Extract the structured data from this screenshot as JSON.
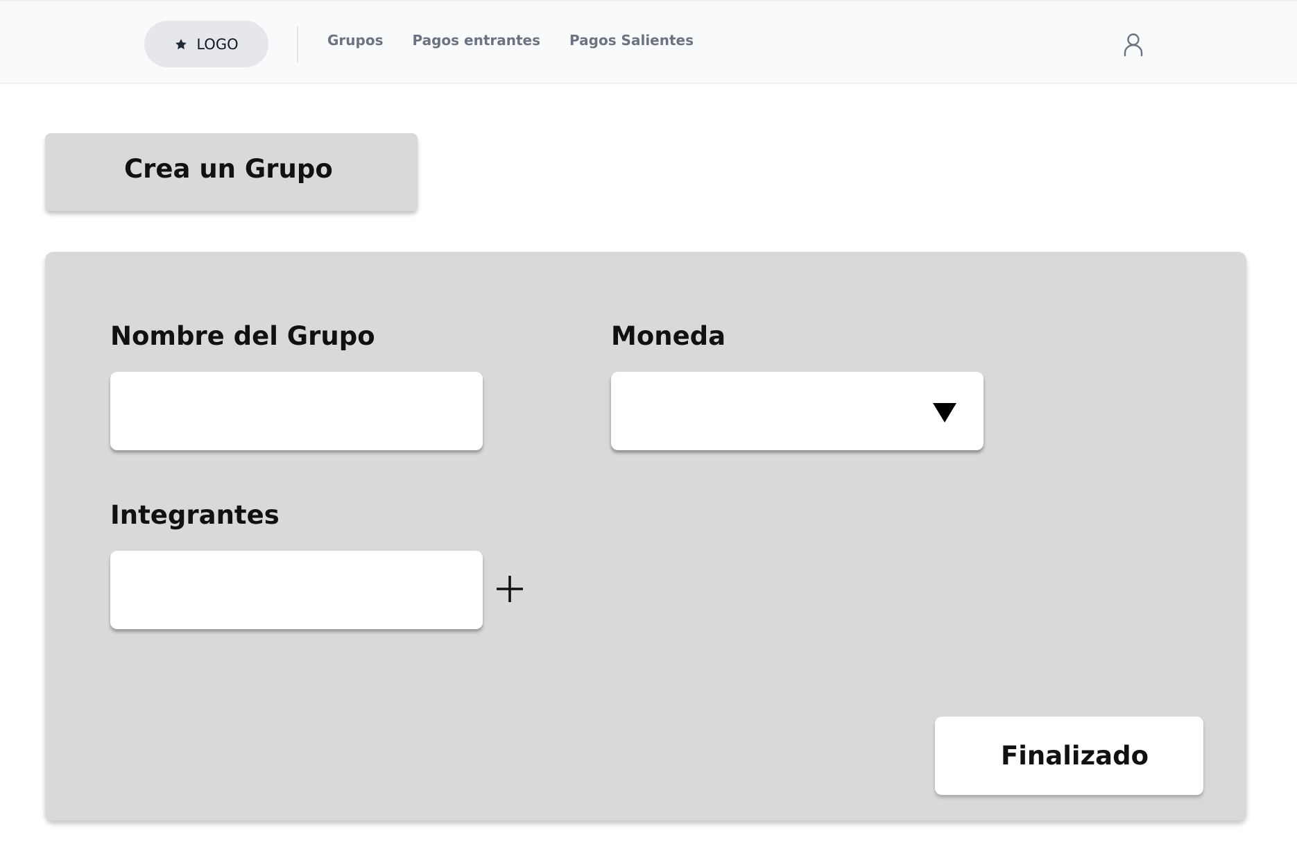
{
  "header": {
    "logo_label": "LOGO",
    "nav": [
      "Grupos",
      "Pagos entrantes",
      "Pagos Salientes"
    ]
  },
  "page": {
    "title": "Crea un Grupo"
  },
  "form": {
    "group_name": {
      "label": "Nombre del Grupo",
      "value": ""
    },
    "currency": {
      "label": "Moneda",
      "selected": ""
    },
    "members": {
      "label": "Integrantes",
      "value": ""
    },
    "add_symbol": "+",
    "submit_label": "Finalizado"
  },
  "icons": {
    "logo": "star-icon",
    "account": "user-icon",
    "dropdown": "triangle-down-icon",
    "add": "plus-icon"
  },
  "colors": {
    "header_bg": "#f9fafb",
    "logo_pill_bg": "#e5e7eb",
    "nav_text": "#6b7280",
    "panel_bg": "#d9d9d9",
    "field_bg": "#ffffff",
    "text": "#111111"
  }
}
